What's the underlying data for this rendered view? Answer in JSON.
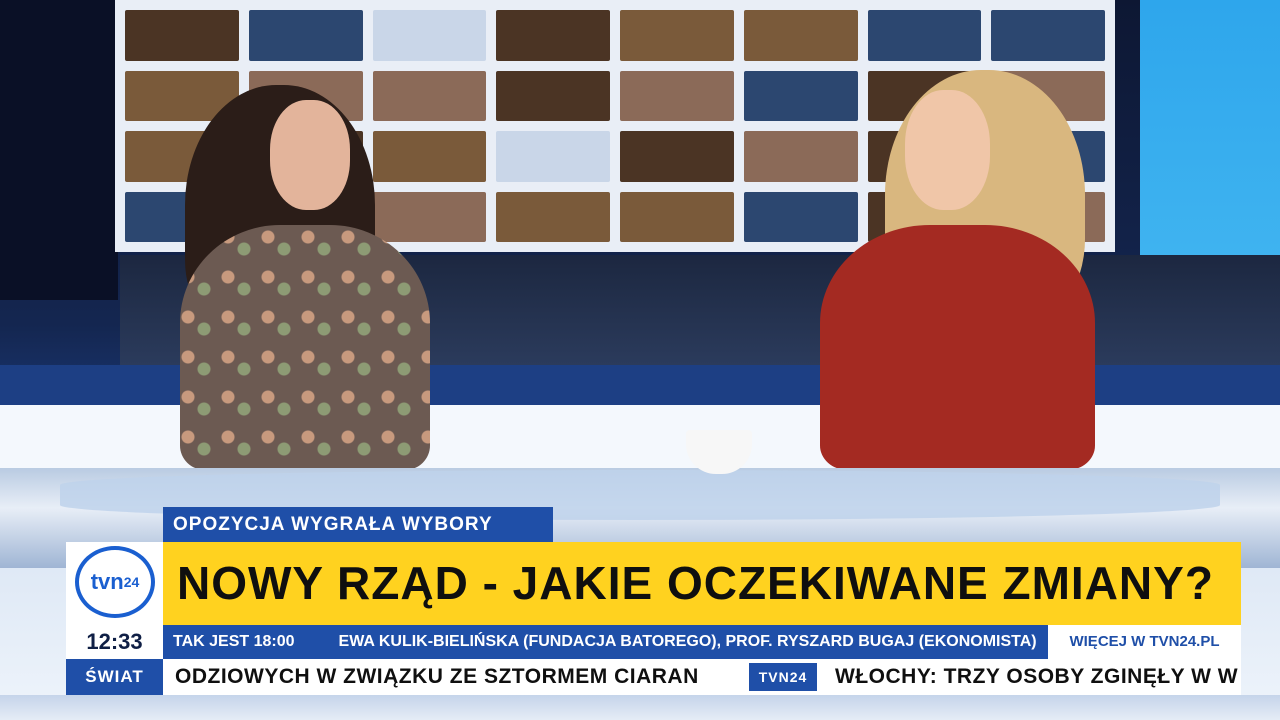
{
  "kicker": "OPOZYCJA WYGRAŁA WYBORY",
  "headline": "NOWY RZĄD - JAKIE OCZEKIWANE ZMIANY?",
  "logo": {
    "name": "tvn",
    "number": "24"
  },
  "clock": "12:33",
  "info_bar": {
    "show": "TAK JEST 18:00",
    "guests": "EWA KULIK-BIELIŃSKA (FUNDACJA BATOREGO), PROF. RYSZARD BUGAJ (EKONOMISTA)"
  },
  "more_link": "WIĘCEJ W TVN24.PL",
  "ticker": {
    "section": "ŚWIAT",
    "item_1": "ODZIOWYCH W ZWIĄZKU ZE SZTORMEM CIARAN",
    "separator": "TVN24",
    "item_2": "WŁOCHY: TRZY OSOBY ZGINĘŁY W W"
  },
  "colors": {
    "accent_blue": "#1f4fa8",
    "headline_yellow": "#ffd21f",
    "logo_blue": "#1a5fd0"
  }
}
